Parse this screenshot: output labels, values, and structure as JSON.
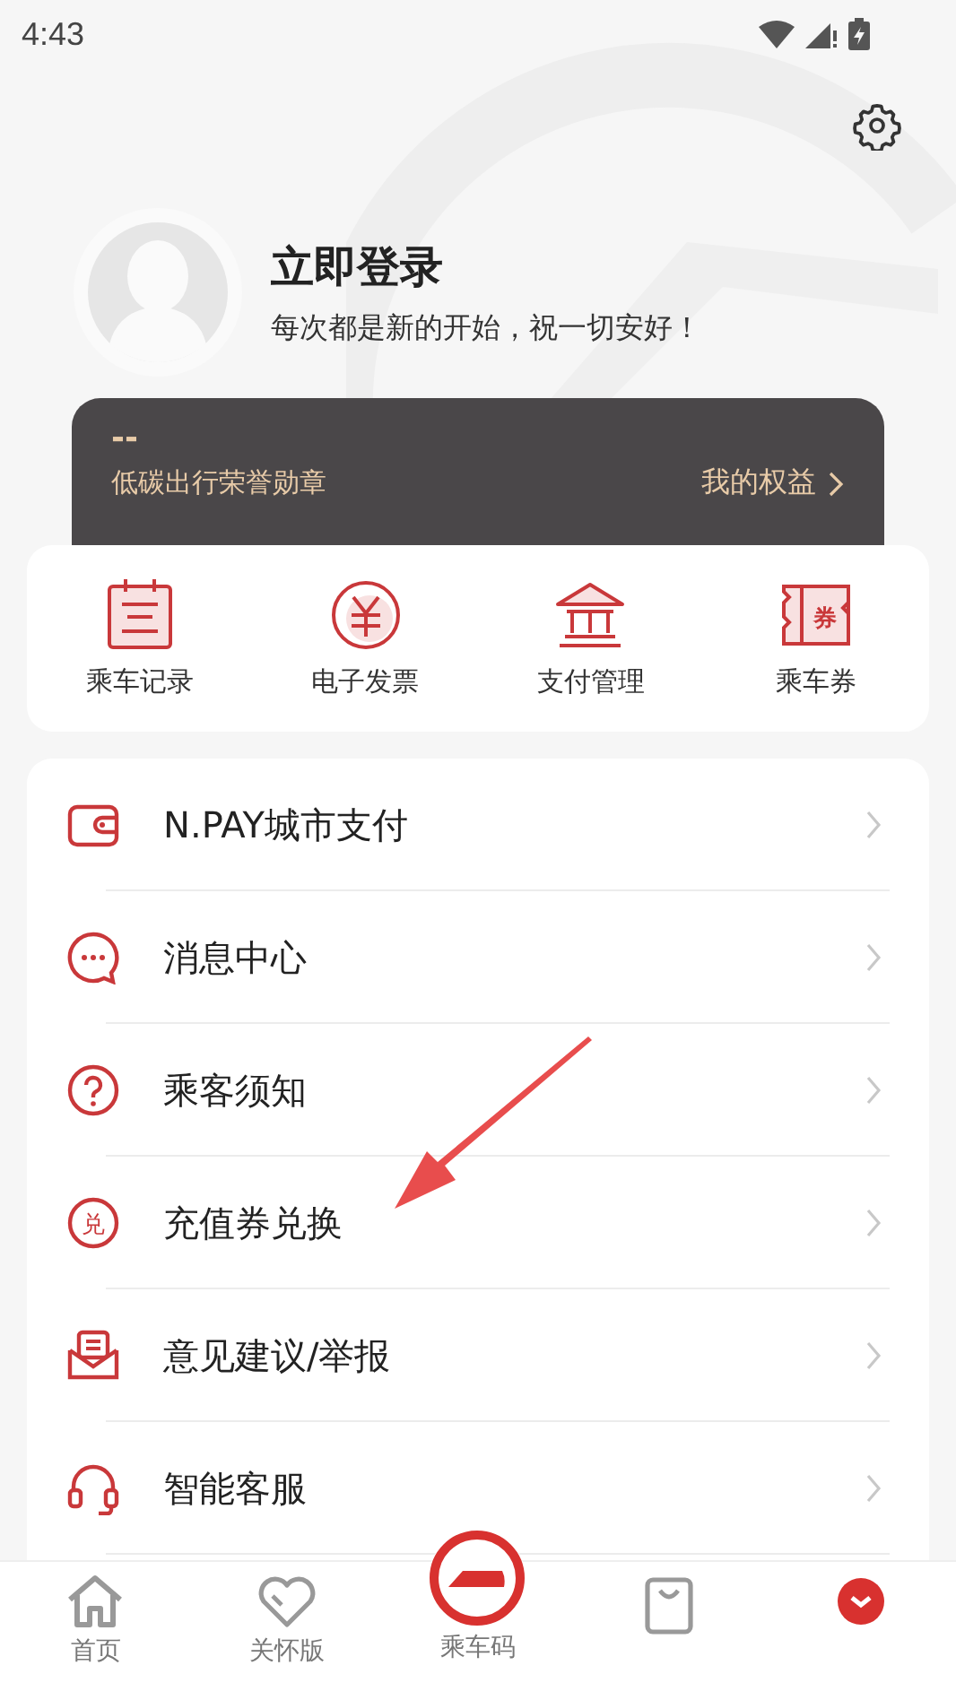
{
  "status_bar": {
    "time": "4:43"
  },
  "profile": {
    "name": "立即登录",
    "greeting": "每次都是新的开始，祝一切安好！"
  },
  "honor_card": {
    "value": "--",
    "title": "低碳出行荣誉勋章",
    "link": "我的权益"
  },
  "shortcuts": [
    {
      "kind": "calendar",
      "label": "乘车记录"
    },
    {
      "kind": "yuan",
      "label": "电子发票"
    },
    {
      "kind": "bank",
      "label": "支付管理"
    },
    {
      "kind": "ticket",
      "label": "乘车券",
      "icon_text": "券"
    }
  ],
  "menu": [
    {
      "kind": "wallet",
      "label": "N.PAY城市支付"
    },
    {
      "kind": "chat",
      "label": "消息中心"
    },
    {
      "kind": "question",
      "label": "乘客须知"
    },
    {
      "kind": "exchange",
      "label": "充值券兑换",
      "icon_text": "兑"
    },
    {
      "kind": "mail",
      "label": "意见建议/举报"
    },
    {
      "kind": "headset",
      "label": "智能客服"
    }
  ],
  "bottom_nav": [
    {
      "kind": "home",
      "label": "首页",
      "selected": false
    },
    {
      "kind": "heart",
      "label": "关怀版",
      "selected": false
    },
    {
      "kind": "logo",
      "label": "乘车码",
      "selected": false
    },
    {
      "kind": "bag",
      "selected": false
    },
    {
      "kind": "user",
      "selected": true
    }
  ]
}
